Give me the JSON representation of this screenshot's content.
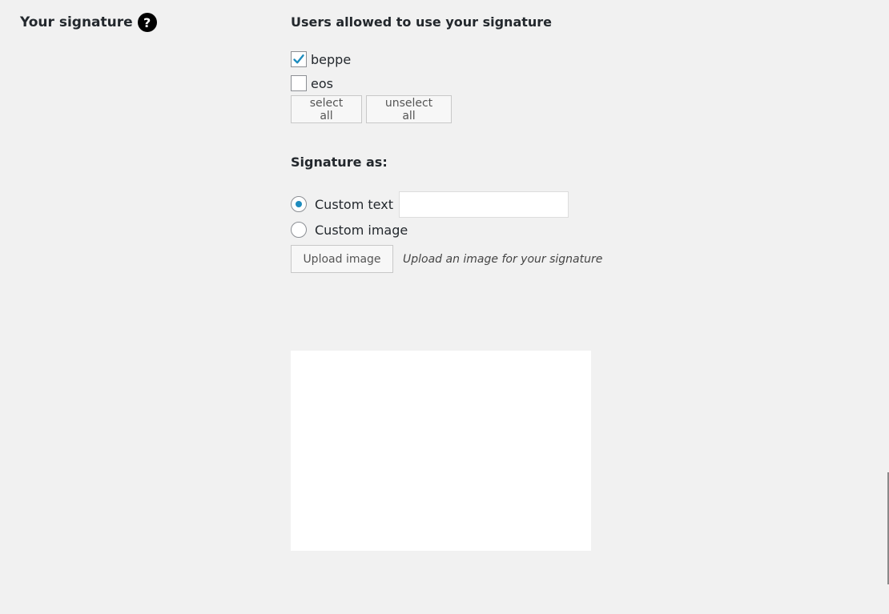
{
  "row_label": "Your signature",
  "help_icon": "?",
  "users_section": {
    "heading": "Users allowed to use your signature",
    "users": [
      {
        "name": "beppe",
        "checked": true
      },
      {
        "name": "eos",
        "checked": false
      }
    ],
    "select_all_label": "select all",
    "unselect_all_label": "unselect all"
  },
  "signature_as": {
    "heading": "Signature as:",
    "custom_text_label": "Custom text",
    "custom_text_value": "",
    "custom_image_label": "Custom image",
    "selected": "custom_text",
    "upload_button_label": "Upload image",
    "upload_description": "Upload an image for your signature"
  },
  "colors": {
    "background": "#f1f1f1",
    "accent": "#1e8cbe",
    "checkmark": "#1e8cbe"
  }
}
